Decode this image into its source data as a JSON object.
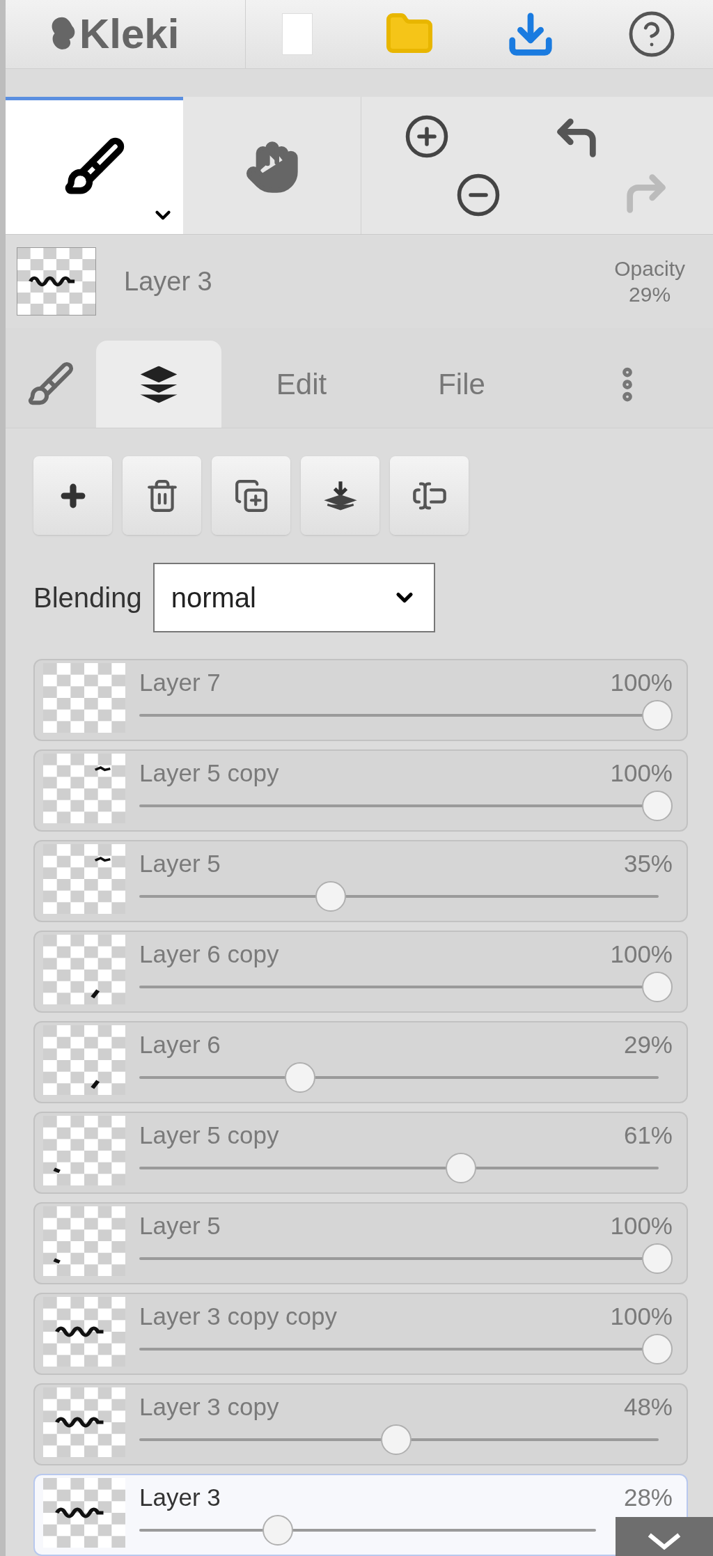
{
  "header": {
    "logo": "Kleki"
  },
  "tools": [
    {
      "kind": "brush",
      "selected": true
    },
    {
      "kind": "hand",
      "selected": false
    }
  ],
  "history": {
    "undo_disabled": false,
    "redo_disabled": true
  },
  "current_layer": {
    "name": "Layer 3",
    "opacity_label": "Opacity",
    "opacity": "29%"
  },
  "tabs": [
    {
      "kind": "brush",
      "selected": false
    },
    {
      "kind": "layers",
      "selected": true
    },
    {
      "kind": "text",
      "label": "Edit",
      "selected": false
    },
    {
      "kind": "text",
      "label": "File",
      "selected": false
    }
  ],
  "blending": {
    "label": "Blending",
    "value": "normal"
  },
  "layers": [
    {
      "name": "Layer 7",
      "opacity": "100%",
      "level": 1,
      "selected": false
    },
    {
      "name": "Layer 5 copy",
      "opacity": "100%",
      "level": 1,
      "selected": false
    },
    {
      "name": "Layer 5",
      "opacity": "35%",
      "level": 0.35,
      "selected": false
    },
    {
      "name": "Layer 6 copy",
      "opacity": "100%",
      "level": 1,
      "selected": false
    },
    {
      "name": "Layer 6",
      "opacity": "29%",
      "level": 0.29,
      "selected": false
    },
    {
      "name": "Layer 5 copy",
      "opacity": "61%",
      "level": 0.61,
      "selected": false
    },
    {
      "name": "Layer 5",
      "opacity": "100%",
      "level": 1,
      "selected": false
    },
    {
      "name": "Layer 3 copy copy",
      "opacity": "100%",
      "level": 1,
      "selected": false
    },
    {
      "name": "Layer 3 copy",
      "opacity": "48%",
      "level": 0.48,
      "selected": false
    },
    {
      "name": "Layer 3",
      "opacity": "28%",
      "level": 0.28,
      "selected": true
    }
  ]
}
